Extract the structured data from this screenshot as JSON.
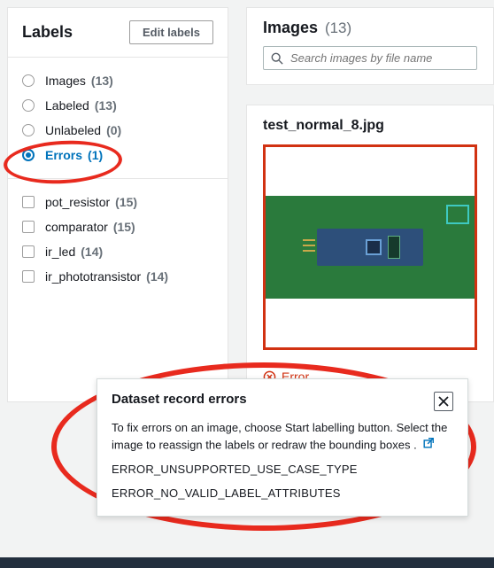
{
  "sidebar": {
    "title": "Labels",
    "edit_button": "Edit labels",
    "filters": [
      {
        "name": "Images",
        "count": "(13)",
        "checked": false
      },
      {
        "name": "Labeled",
        "count": "(13)",
        "checked": false
      },
      {
        "name": "Unlabeled",
        "count": "(0)",
        "checked": false
      },
      {
        "name": "Errors",
        "count": "(1)",
        "checked": true
      }
    ],
    "labels": [
      {
        "name": "pot_resistor",
        "count": "(15)"
      },
      {
        "name": "comparator",
        "count": "(15)"
      },
      {
        "name": "ir_led",
        "count": "(14)"
      },
      {
        "name": "ir_phototransistor",
        "count": "(14)"
      }
    ]
  },
  "images_panel": {
    "title": "Images",
    "count": "(13)",
    "search_placeholder": "Search images by file name"
  },
  "card": {
    "filename": "test_normal_8.jpg",
    "error_badge": "Error"
  },
  "popover": {
    "title": "Dataset record errors",
    "help_text": "To fix errors on an image, choose Start labelling button. Select the image to reassign the labels or redraw the bounding boxes .",
    "errors": [
      "ERROR_UNSUPPORTED_USE_CASE_TYPE",
      "ERROR_NO_VALID_LABEL_ATTRIBUTES"
    ]
  }
}
